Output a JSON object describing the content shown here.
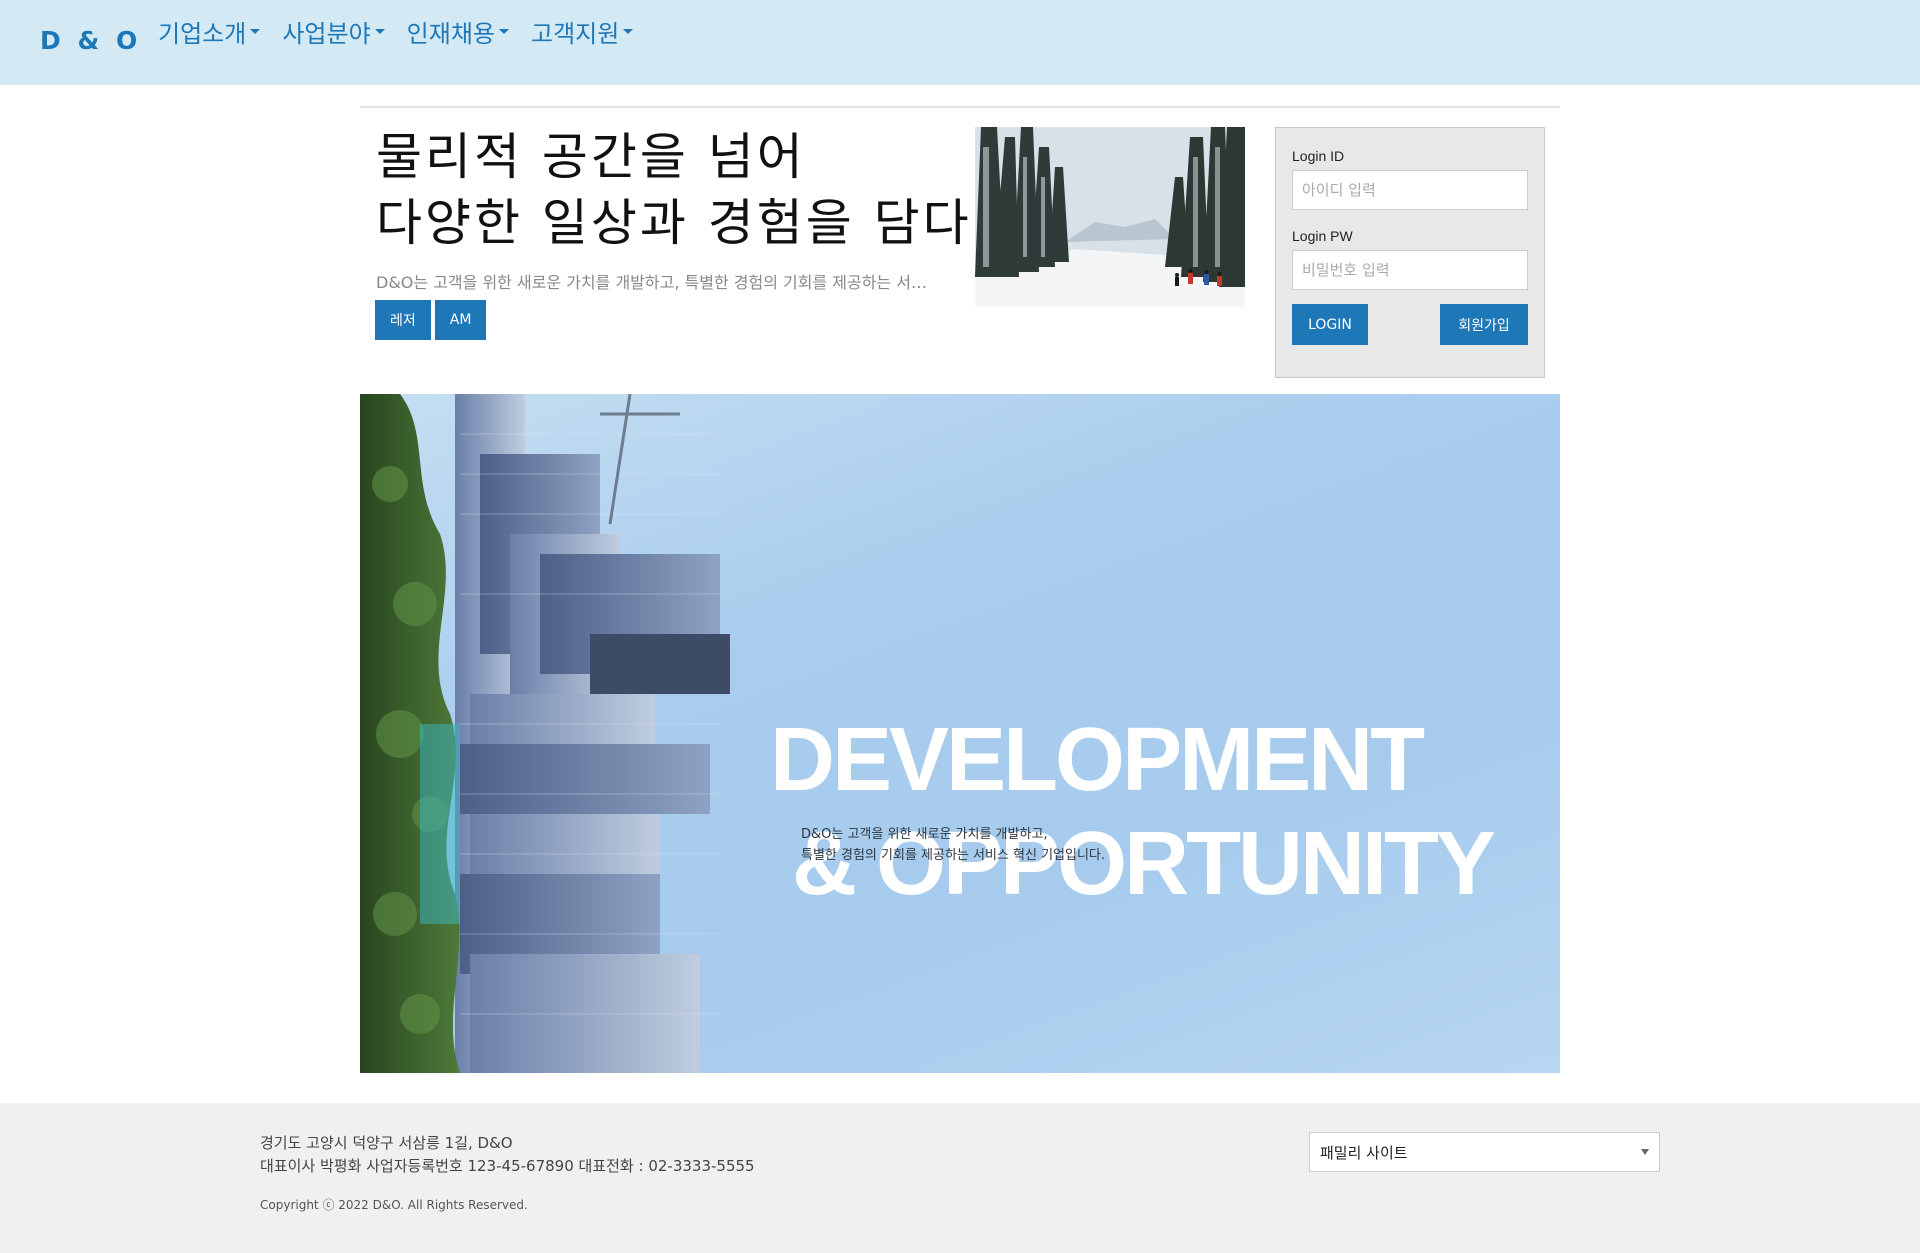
{
  "nav": {
    "brand": "D & O",
    "items": [
      {
        "label": "기업소개"
      },
      {
        "label": "사업분야"
      },
      {
        "label": "인재채용"
      },
      {
        "label": "고객지원"
      }
    ]
  },
  "hero": {
    "title": "물리적 공간을 넘어\n다양한 일상과 경험을 담다",
    "description": "D&O는 고객을 위한 새로운 가치를 개발하고, 특별한 경험의 기회를 제공하는 서비스 혁신 기업입니다.",
    "tags": [
      "레저",
      "AM"
    ]
  },
  "login": {
    "id_label": "Login ID",
    "id_placeholder": "아이디 입력",
    "pw_label": "Login PW",
    "pw_placeholder": "비밀번호 입력",
    "login_button": "LOGIN",
    "signup_button": "회원가입"
  },
  "banner": {
    "heading_line1": "DEVELOPMENT",
    "heading_line2": "& OPPORTUNITY",
    "subtext": "D&O는 고객을 위한 새로운 가치를 개발하고,\n특별한 경험의 기회를 제공하는 서비스 혁신 기업입니다."
  },
  "footer": {
    "address": "경기도 고양시 덕양구 서삼릉 1길, D&O\n대표이사 박평화 사업자등록번호 123-45-67890 대표전화 : 02-3333-5555",
    "copyright": "Copyright ⓒ 2022 D&O. All Rights Reserved.",
    "family_site": "패밀리 사이트"
  },
  "colors": {
    "navbar_bg": "#d3e9f4",
    "accent": "#1e78b8",
    "footer_bg": "#f0f0f0",
    "banner_sky": "#a9cdee"
  }
}
